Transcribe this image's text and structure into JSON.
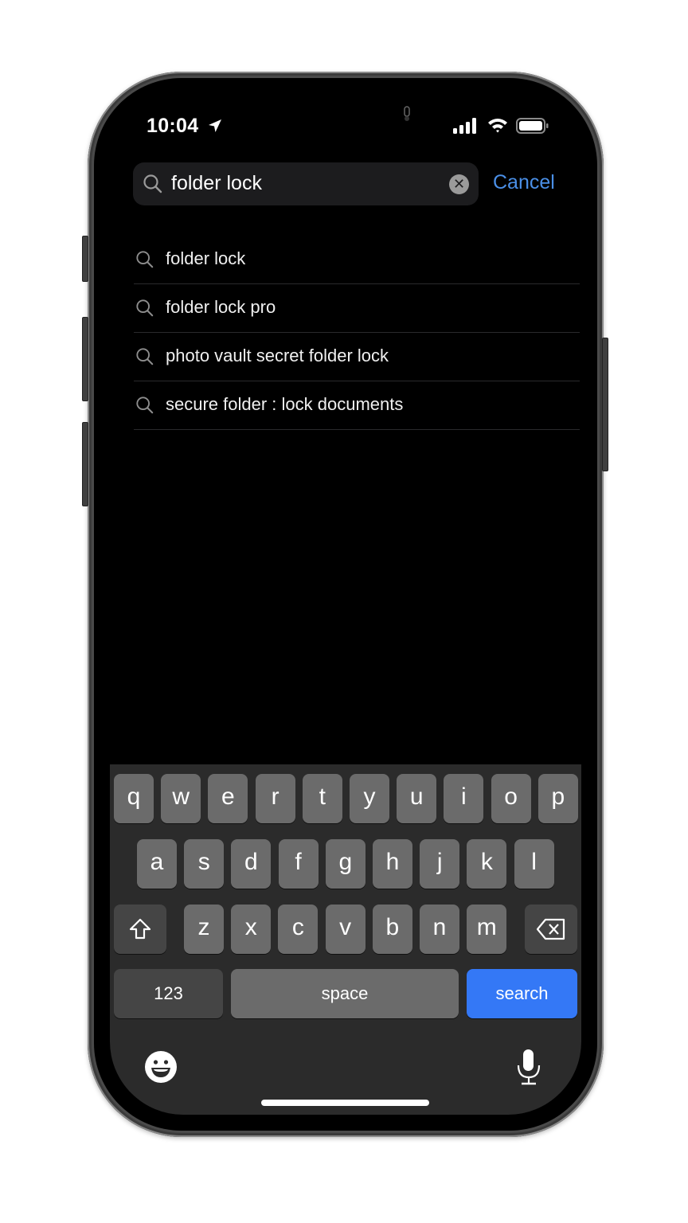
{
  "status_bar": {
    "time": "10:04",
    "icons": [
      "location-arrow-icon",
      "cellular-signal-icon",
      "wifi-icon",
      "battery-icon"
    ]
  },
  "search": {
    "query": "folder lock",
    "cancel_label": "Cancel",
    "icon": "search-icon",
    "clear_icon": "clear-icon"
  },
  "suggestions": [
    {
      "label": "folder lock"
    },
    {
      "label": "folder lock pro"
    },
    {
      "label": "photo vault secret folder lock"
    },
    {
      "label": "secure folder : lock documents"
    }
  ],
  "keyboard": {
    "row1": [
      "q",
      "w",
      "e",
      "r",
      "t",
      "y",
      "u",
      "i",
      "o",
      "p"
    ],
    "row2": [
      "a",
      "s",
      "d",
      "f",
      "g",
      "h",
      "j",
      "k",
      "l"
    ],
    "row3": [
      "z",
      "x",
      "c",
      "v",
      "b",
      "n",
      "m"
    ],
    "numbers_label": "123",
    "space_label": "space",
    "return_label": "search",
    "icons": [
      "shift-icon",
      "delete-icon",
      "emoji-icon",
      "microphone-icon"
    ]
  },
  "colors": {
    "accent": "#4a8fe7",
    "return_key": "#3478f6",
    "keyboard_bg": "#2b2b2b",
    "key_bg": "#6b6b6b"
  }
}
